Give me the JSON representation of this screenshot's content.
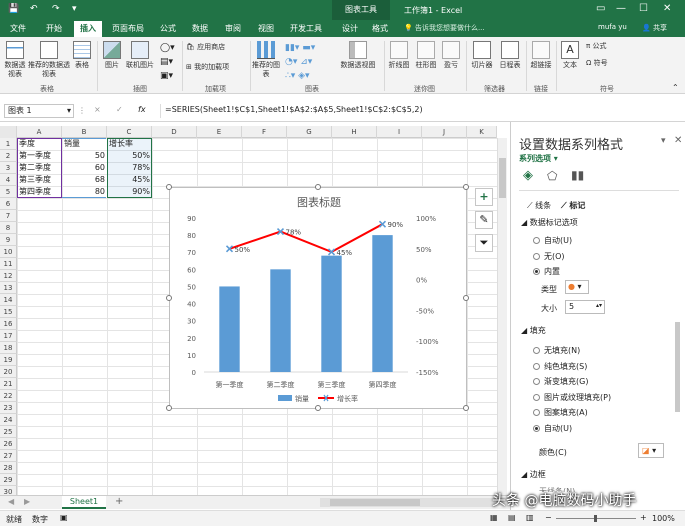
{
  "titlebar": {
    "context_group": "图表工具",
    "title": "工作簿1 - Excel",
    "icons": [
      "save-icon",
      "undo-icon",
      "redo-icon",
      "quick-access-dropdown-icon"
    ]
  },
  "tabs": [
    "文件",
    "开始",
    "插入",
    "页面布局",
    "公式",
    "数据",
    "审阅",
    "视图",
    "开发工具",
    "设计",
    "格式"
  ],
  "active_tab": "插入",
  "tell_me": "告诉我您想要做什么...",
  "user": {
    "name": "mufa yu",
    "share": "共享"
  },
  "ribbon": {
    "groups": [
      "表格",
      "插图",
      "加载项",
      "图表",
      "迷你图",
      "筛选器",
      "链接",
      "符号"
    ],
    "buttons": [
      "数据透视表",
      "推荐的数据透视表",
      "表格",
      "图片",
      "联机图片",
      "应用商店",
      "我的加载项",
      "推荐的图表",
      "数据透视图",
      "折线图",
      "柱形图",
      "盈亏",
      "切片器",
      "日程表",
      "超链接",
      "文本",
      "公式",
      "符号"
    ]
  },
  "formula_bar": {
    "name_box": "图表 1",
    "cancel": "×",
    "enter": "✓",
    "fx": "fx",
    "formula": "=SERIES(Sheet1!$C$1,Sheet1!$A$2:$A$5,Sheet1!$C$2:$C$5,2)"
  },
  "columns": [
    "A",
    "B",
    "C",
    "D",
    "E",
    "F",
    "G",
    "H",
    "I",
    "J",
    "K"
  ],
  "rows": [
    "1",
    "2",
    "3",
    "4",
    "5",
    "6",
    "7",
    "8",
    "9",
    "10",
    "11",
    "12",
    "13",
    "14",
    "15",
    "16",
    "17",
    "18",
    "19",
    "20",
    "21",
    "22",
    "23",
    "24",
    "25",
    "26",
    "27",
    "28",
    "29",
    "30"
  ],
  "cells": {
    "A1": "季度",
    "B1": "销量",
    "C1": "增长率",
    "A2": "第一季度",
    "B2": "50",
    "C2": "50%",
    "A3": "第二季度",
    "B3": "60",
    "C3": "78%",
    "A4": "第三季度",
    "B4": "68",
    "C4": "45%",
    "A5": "第四季度",
    "B5": "80",
    "C5": "90%"
  },
  "chart_data": {
    "type": "bar",
    "title": "图表标题",
    "categories": [
      "第一季度",
      "第二季度",
      "第三季度",
      "第四季度"
    ],
    "series": [
      {
        "name": "销量",
        "type": "bar",
        "axis": "left",
        "values": [
          50,
          60,
          68,
          80
        ],
        "color": "#5b9bd5"
      },
      {
        "name": "增长率",
        "type": "line",
        "axis": "right",
        "values": [
          0.5,
          0.78,
          0.45,
          0.9
        ],
        "labels": [
          "50%",
          "78%",
          "45%",
          "90%"
        ],
        "color": "#ff0000",
        "marker": "x",
        "marker_color": "#5b9bd5"
      }
    ],
    "y_left": {
      "ylim": [
        0,
        90
      ],
      "ticks": [
        "0",
        "10",
        "20",
        "30",
        "40",
        "50",
        "60",
        "70",
        "80",
        "90"
      ]
    },
    "y_right": {
      "ylim": [
        -1.5,
        1.0
      ],
      "ticks": [
        "-150%",
        "-100%",
        "-50%",
        "0%",
        "50%",
        "100%"
      ]
    },
    "legend": "bottom",
    "grid": false
  },
  "chart_buttons": [
    "add-chart-element-icon",
    "chart-styles-icon",
    "chart-filters-icon"
  ],
  "sheet": {
    "tab": "Sheet1",
    "add": "+"
  },
  "status": {
    "ready": "就绪",
    "mode": "数字",
    "zoom": "100%"
  },
  "pane": {
    "title": "设置数据系列格式",
    "options_label": "系列选项",
    "tabs": [
      "线条",
      "标记"
    ],
    "marker_options": "数据标记选项",
    "radio_marker": [
      "自动(U)",
      "无(O)",
      "内置"
    ],
    "type_label": "类型",
    "size_label": "大小",
    "size_value": "5",
    "fill_section": "填充",
    "radio_fill": [
      "无填充(N)",
      "纯色填充(S)",
      "渐变填充(G)",
      "图片或纹理填充(P)",
      "图案填充(A)",
      "自动(U)"
    ],
    "color_label": "颜色(C)",
    "border_section": "边框",
    "border_sub": "无线条(N)"
  },
  "watermark": "头条 @电脑数码小助手"
}
